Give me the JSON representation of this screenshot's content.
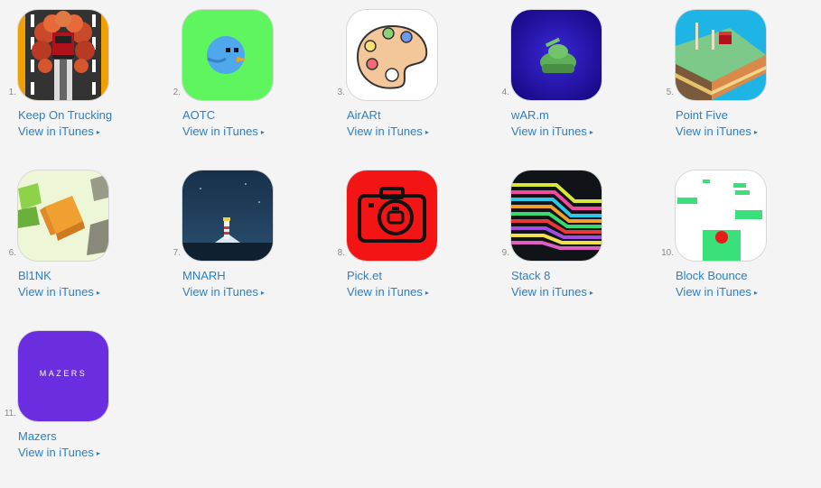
{
  "link_label": "View in iTunes",
  "chevron": "▸",
  "apps": [
    {
      "rank": "1.",
      "name": "Keep On Trucking",
      "icon": "truck-road-icon"
    },
    {
      "rank": "2.",
      "name": "AOTC",
      "icon": "blue-bird-icon"
    },
    {
      "rank": "3.",
      "name": "AirARt",
      "icon": "paint-palette-icon"
    },
    {
      "rank": "4.",
      "name": "wAR.m",
      "icon": "tank-icon"
    },
    {
      "rank": "5.",
      "name": "Point Five",
      "icon": "cube-platform-icon"
    },
    {
      "rank": "6.",
      "name": "Bl1NK",
      "icon": "voxel-cube-icon"
    },
    {
      "rank": "7.",
      "name": "MNARH",
      "icon": "lighthouse-icon"
    },
    {
      "rank": "8.",
      "name": "Pick.et",
      "icon": "camera-robot-icon"
    },
    {
      "rank": "9.",
      "name": "Stack 8",
      "icon": "neon-stripes-icon"
    },
    {
      "rank": "10.",
      "name": "Block Bounce",
      "icon": "bouncing-ball-icon"
    },
    {
      "rank": "11.",
      "name": "Mazers",
      "icon": "mazers-logo-icon",
      "logo_text": "MAZERS"
    }
  ]
}
